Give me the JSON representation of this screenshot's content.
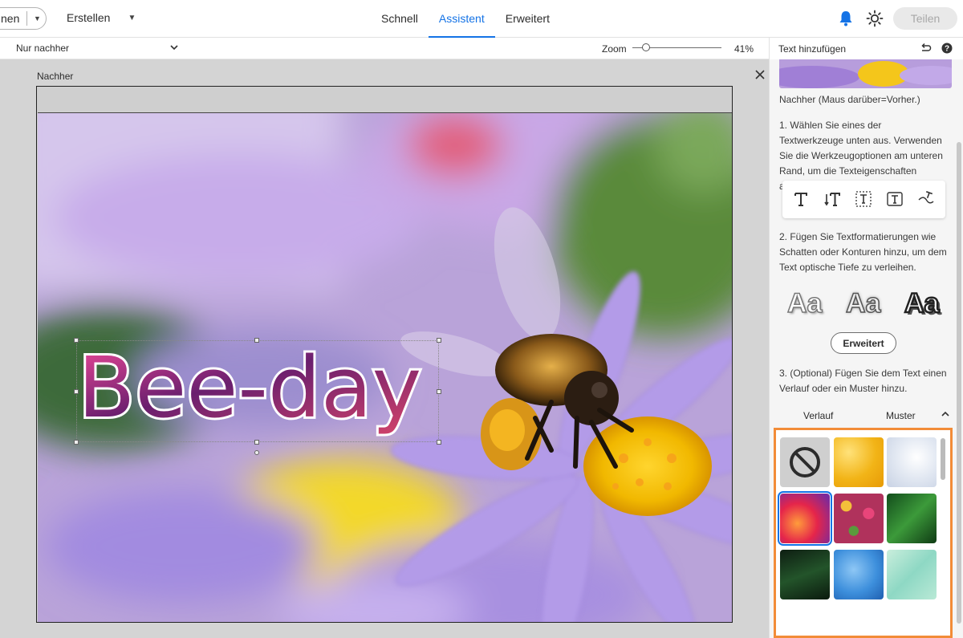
{
  "topbar": {
    "open_label": "nen",
    "create_label": "Erstellen",
    "modes": [
      "Schnell",
      "Assistent",
      "Erweitert"
    ],
    "active_mode": "Assistent",
    "share_label": "Teilen"
  },
  "subbar": {
    "view_mode": "Nur nachher",
    "zoom_label": "Zoom",
    "zoom_value": "41%",
    "zoom_level": 0.12
  },
  "canvas": {
    "after_label": "Nachher",
    "text_layer": "Bee-day"
  },
  "panel": {
    "title": "Text hinzufügen",
    "thumb_caption": "Nachher (Maus darüber=Vorher.)",
    "step1": "1. Wählen Sie eines der Textwerkzeuge unten aus. Verwenden Sie die Werkzeugoptionen am unteren Rand, um die Texteigenschaften anzupassen.",
    "tools": [
      "horizontal-type-icon",
      "vertical-type-icon",
      "text-on-selection-icon",
      "text-on-shape-icon",
      "text-on-path-icon"
    ],
    "step2": "2. Fügen Sie Textformatierungen wie Schatten oder Konturen hinzu, um dem Text optische Tiefe zu verleihen.",
    "styles": [
      "Aa",
      "Aa",
      "Aa"
    ],
    "advanced_button": "Erweitert",
    "step3": "3. (Optional) Fügen Sie dem Text einen Verlauf oder ein Muster hinzu.",
    "tab_gradient": "Verlauf",
    "tab_pattern": "Muster",
    "patterns": [
      "none",
      "gold-foil",
      "snow-bokeh",
      "red-watercolor",
      "flowers",
      "green-leaves",
      "dark-leaves",
      "blue-glitter",
      "aqua-water"
    ],
    "selected_pattern": "red-watercolor",
    "colors": {
      "accent": "#1473e6",
      "highlight": "#f28c38"
    }
  }
}
